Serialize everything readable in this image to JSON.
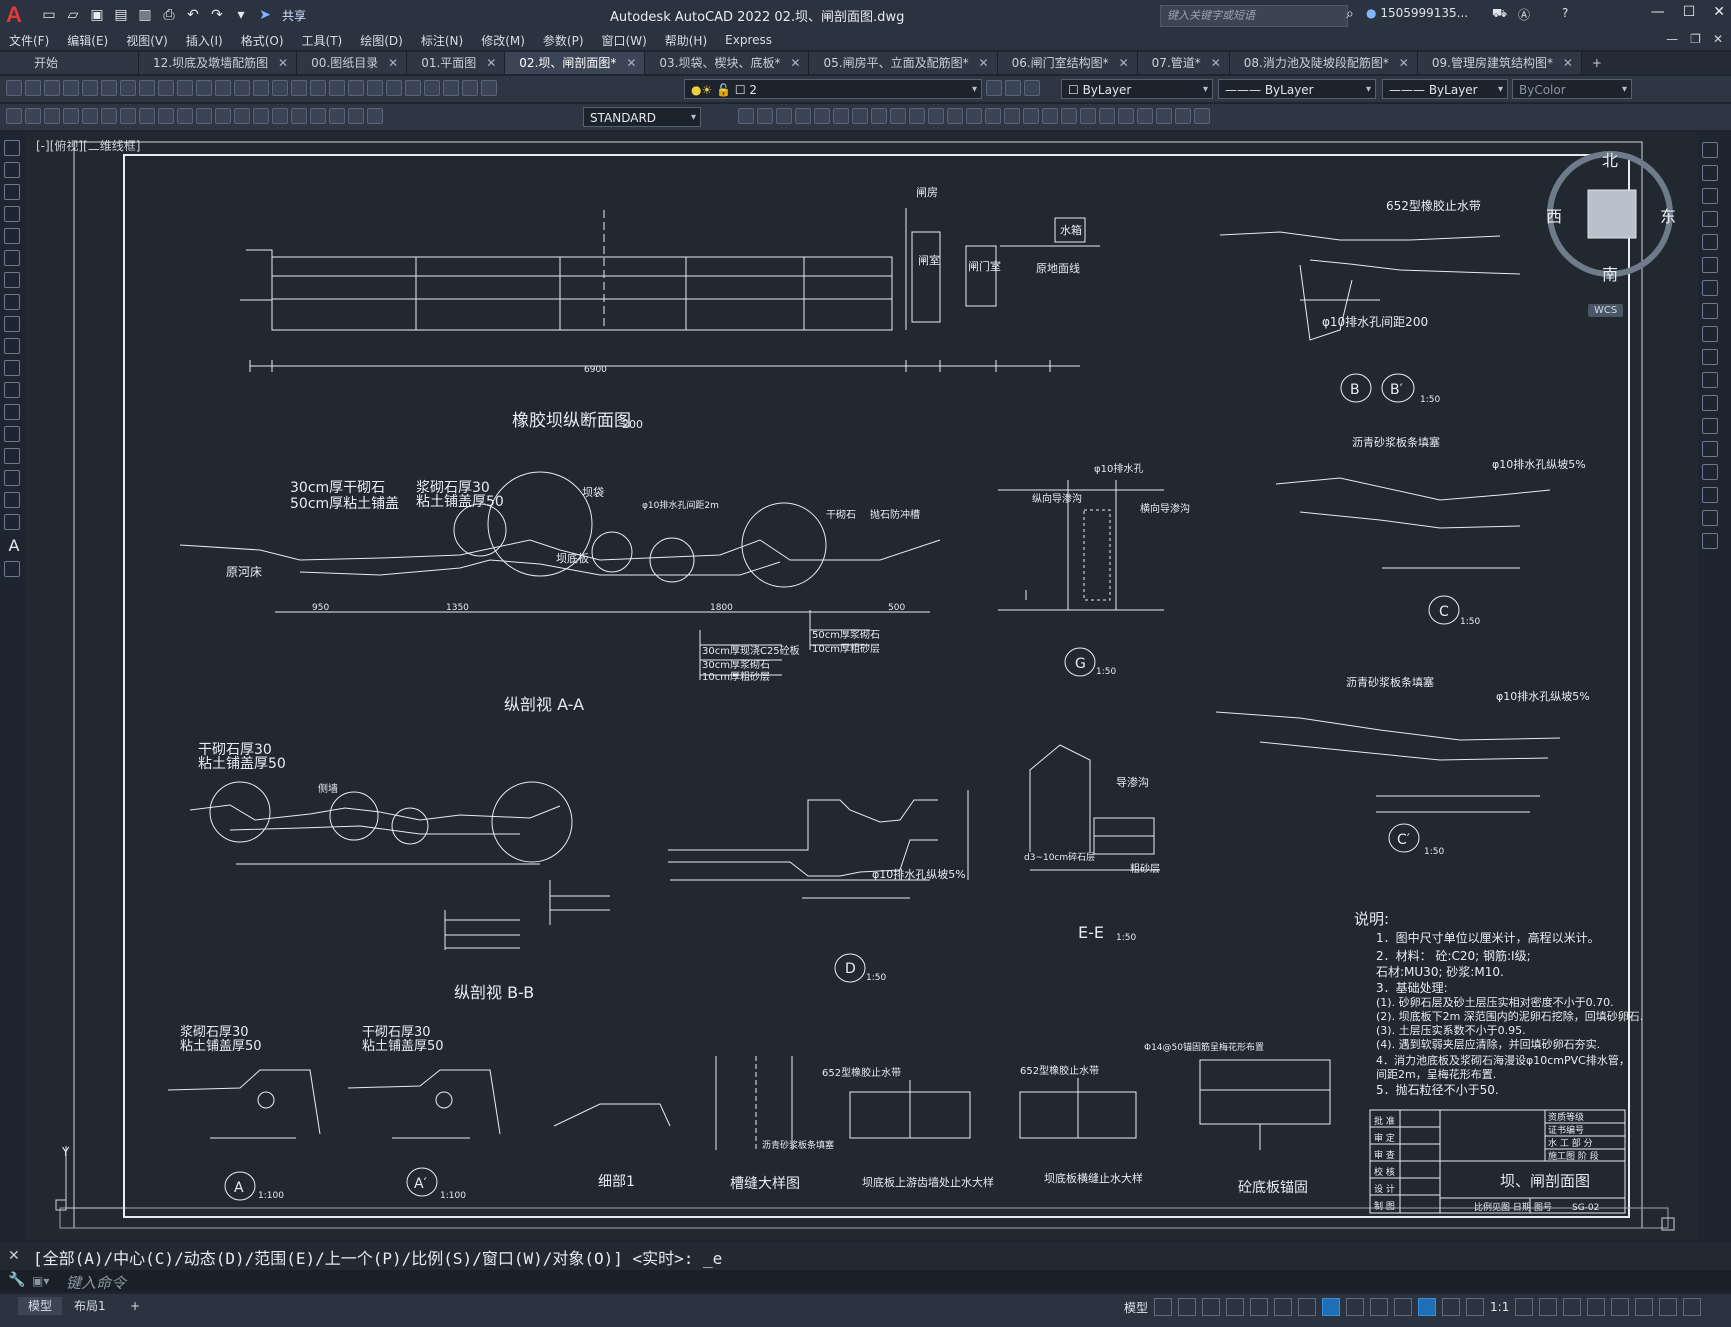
{
  "titlebar": {
    "logo": "A",
    "share_label": "共享",
    "app_title": "Autodesk AutoCAD 2022    02.坝、闸剖面图.dwg",
    "search_placeholder": "键入关键字或短语",
    "user": "1505999135..."
  },
  "menu": {
    "items": [
      "文件(F)",
      "编辑(E)",
      "视图(V)",
      "插入(I)",
      "格式(O)",
      "工具(T)",
      "绘图(D)",
      "标注(N)",
      "修改(M)",
      "参数(P)",
      "窗口(W)",
      "帮助(H)",
      "Express"
    ]
  },
  "tabs": [
    {
      "label": "开始",
      "closable": false,
      "active": false
    },
    {
      "label": "12.坝底及墩墙配筋图",
      "closable": true,
      "active": false
    },
    {
      "label": "00.图纸目录",
      "closable": true,
      "active": false
    },
    {
      "label": "01.平面图",
      "closable": true,
      "active": false
    },
    {
      "label": "02.坝、闸剖面图*",
      "closable": true,
      "active": true
    },
    {
      "label": "03.坝袋、楔块、底板*",
      "closable": true,
      "active": false
    },
    {
      "label": "05.闸房平、立面及配筋图*",
      "closable": true,
      "active": false
    },
    {
      "label": "06.闸门室结构图*",
      "closable": true,
      "active": false
    },
    {
      "label": "07.管道*",
      "closable": true,
      "active": false
    },
    {
      "label": "08.消力池及陡坡段配筋图*",
      "closable": true,
      "active": false
    },
    {
      "label": "09.管理房建筑结构图*",
      "closable": true,
      "active": false
    }
  ],
  "toolbar": {
    "layer": "2",
    "color": "ByLayer",
    "linetype": "ByLayer",
    "lineweight": "ByLayer",
    "plotstyle": "ByColor",
    "textstyle": "STANDARD"
  },
  "viewport": {
    "label": "[-][俯视][二维线框]",
    "compass": {
      "n": "北",
      "s": "南",
      "e": "东",
      "w": "西"
    },
    "wcs": "WCS"
  },
  "drawing": {
    "titles": {
      "longitudinal": "橡胶坝纵断面图",
      "scale_200": "200",
      "aa": "纵剖视 A-A",
      "bb": "纵剖视 B-B",
      "g": "G",
      "ee": "E-E",
      "b": "B",
      "bp": "B′",
      "c": "C",
      "cp": "C′",
      "d": "D",
      "a": "A",
      "ap": "A′",
      "s150": "1:50",
      "s1100": "1:100",
      "detail1": "细部1",
      "joint": "槽缝大样图",
      "stop1": "坝底板上游齿墙处止水大样",
      "stop2": "坝底板横缝止水大样",
      "slab": "砼底板锚固"
    },
    "labels": {
      "dam_house": "闸房",
      "gate_room": "闸室",
      "gate_well": "闸门室",
      "water_box": "水箱",
      "orig_ground": "原地面线",
      "riverbed": "原河床",
      "stone30": "30cm厚干砌石",
      "clay50": "50cm厚粘土铺盖",
      "mortar30": "浆砌石厚30",
      "clay_cover50": "粘土铺盖厚50",
      "dam_bag": "坝袋",
      "dam_slab": "坝底板",
      "drain_hole": "φ10排水孔间距2m",
      "dry_stone": "干砌石",
      "anti_scour": "抛石防冲槽",
      "c25": "30cm厚现浇C25砼板",
      "mortar_stone": "30cm厚浆砌石",
      "sand10": "10cm厚粗砂层",
      "mortar50": "50cm厚浆砌石",
      "sand10b": "10cm厚粗砂层",
      "dry30": "干砌石厚30",
      "clay_top50": "粘土铺盖厚50",
      "side_wall": "侧墙",
      "waterstop652": "652型橡胶止水带",
      "drain_pitch": "φ10排水孔间距200",
      "asphalt": "沥青砂浆板条填塞",
      "drain5": "φ10排水孔纵坡5%",
      "v_drain": "纵向导渗沟",
      "h_drain": "横向导渗沟",
      "drain10": "φ10排水孔",
      "guide": "导渗沟",
      "filter": "粗砂层",
      "stone_bed": "d3~10cm碎石层",
      "pvc": "Φ14@50锚固筋呈梅花形布置"
    },
    "notes": {
      "heading": "说明:",
      "lines": [
        "1．图中尺寸单位以厘米计，高程以米计。",
        "2．材料： 砼:C20;   钢筋:I级;",
        "         石材:MU30;   砂浆:M10.",
        "3．基础处理:",
        "  (1). 砂卵石层及砂土层压实相对密度不小于0.70.",
        "  (2). 坝底板下2m 深范围内的泥卵石挖除，回填砂卵石.",
        "  (3). 土层压实系数不小于0.95.",
        "  (4). 遇到软弱夹层应清除，并回填砂卵石夯实.",
        "4．消力池底板及浆砌石海漫设φ10cmPVC排水管，",
        "   间距2m，呈梅花形布置.",
        "5．抛石粒径不小于50."
      ]
    },
    "titleblock": {
      "title": "坝、闸剖面图",
      "drawing_no": "SG-02",
      "rows": [
        "批 准",
        "审 定",
        "审 查",
        "校 核",
        "设 计",
        "制 图"
      ],
      "stage1": "资质等级",
      "stage2": "证书编号",
      "stage3": "水 工 部 分",
      "stage4": "施工图 阶 段",
      "scale_row": "比例见图  日期",
      "no_label": "图号"
    },
    "dims": {
      "d6900": "6900",
      "d950": "950",
      "d1350": "1350",
      "d1800": "1800",
      "d500": "500"
    }
  },
  "command": {
    "prompt": "[全部(A)/中心(C)/动态(D)/范围(E)/上一个(P)/比例(S)/窗口(W)/对象(O)] <实时>: _e",
    "placeholder": "键入命令"
  },
  "status": {
    "model_tab": "模型",
    "layout_tab": "布局1",
    "model_btn": "模型",
    "scale": "1:1"
  }
}
